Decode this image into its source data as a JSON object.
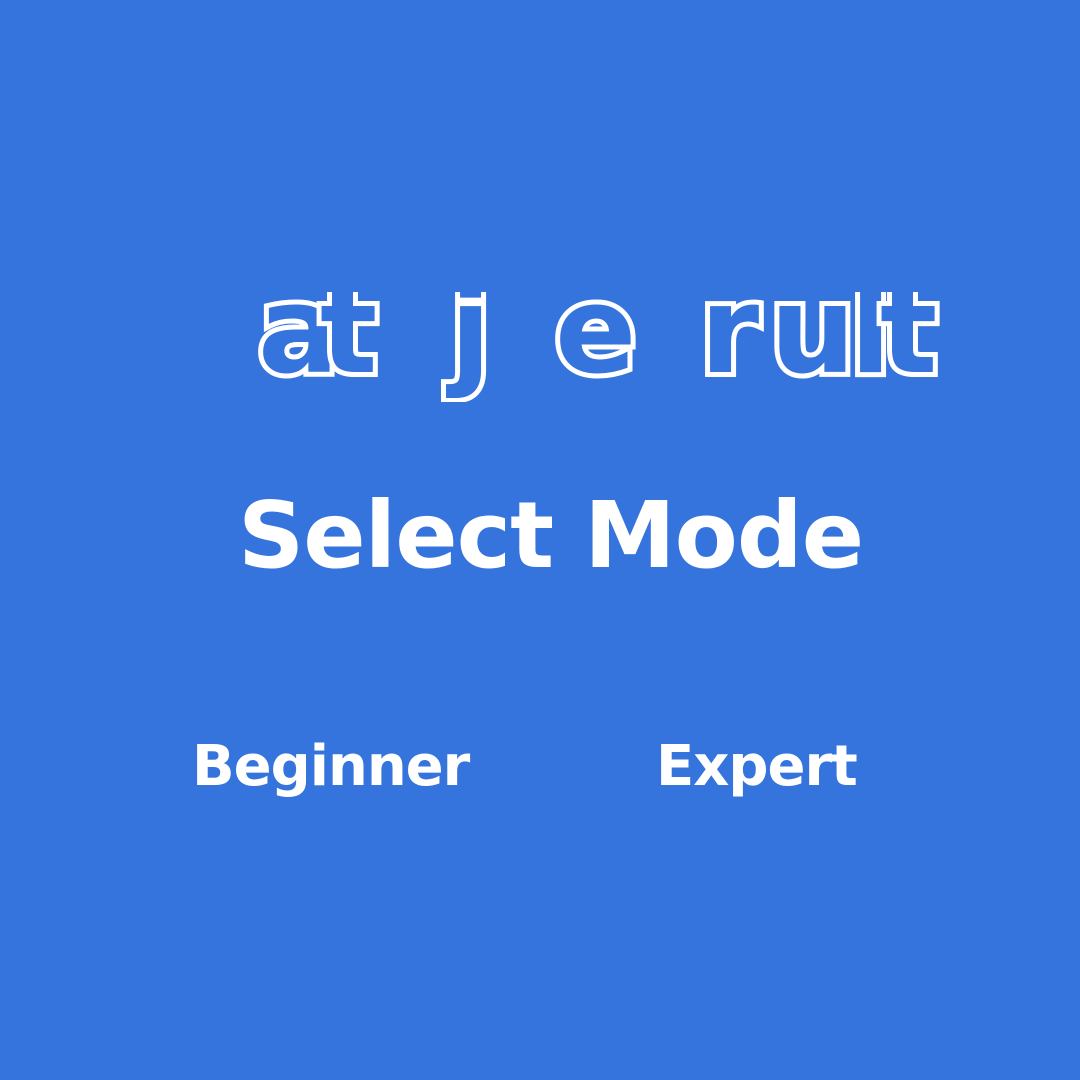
{
  "colors": {
    "background": "#3574DC",
    "text": "#FFFFFF"
  },
  "logo": {
    "fragments": [
      "a",
      "t",
      "j",
      "e",
      "r",
      "u",
      "l",
      "t"
    ]
  },
  "mode_select": {
    "title": "Select Mode",
    "options": [
      "Beginner",
      "Expert"
    ]
  }
}
